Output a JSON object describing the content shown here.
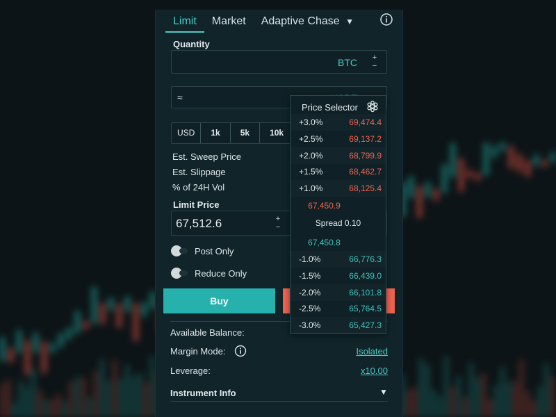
{
  "tabs": {
    "limit": "Limit",
    "market": "Market",
    "adaptive": "Adaptive Chase",
    "adaptive_arrow": "▼"
  },
  "quantity": {
    "label": "Quantity",
    "unit": "BTC",
    "stepper_up": "+",
    "stepper_down": "−"
  },
  "notional": {
    "approx": "≈",
    "unit": "USDT"
  },
  "chips": [
    "USD",
    "1k",
    "5k",
    "10k"
  ],
  "stats": {
    "sweep": "Est. Sweep Price",
    "slippage": "Est. Slippage",
    "vol": "% of 24H Vol"
  },
  "limit_price": {
    "label": "Limit Price",
    "value": "67,512.6",
    "stepper_up": "+",
    "stepper_down": "−"
  },
  "toggles": {
    "post_only": "Post Only",
    "reduce_only": "Reduce Only"
  },
  "buttons": {
    "buy": "Buy"
  },
  "info": {
    "balance_label": "Available Balance:",
    "margin_label": "Margin Mode:",
    "margin_value": "Isolated",
    "leverage_label": "Leverage:",
    "leverage_value": "x10.00",
    "instrument": "Instrument Info",
    "instrument_arrow": "▼"
  },
  "price_selector": {
    "title": "Price Selector",
    "asks": [
      {
        "pct": "+3.0%",
        "price": "69,474.4"
      },
      {
        "pct": "+2.5%",
        "price": "69,137.2"
      },
      {
        "pct": "+2.0%",
        "price": "68,799.9"
      },
      {
        "pct": "+1.5%",
        "price": "68,462.7"
      },
      {
        "pct": "+1.0%",
        "price": "68,125.4"
      }
    ],
    "best_ask": "67,450.9",
    "spread": "Spread 0.10",
    "best_bid": "67,450.8",
    "bids": [
      {
        "pct": "-1.0%",
        "price": "66,776.3"
      },
      {
        "pct": "-1.5%",
        "price": "66,439.0"
      },
      {
        "pct": "-2.0%",
        "price": "66,101.8"
      },
      {
        "pct": "-2.5%",
        "price": "65,764.5"
      },
      {
        "pct": "-3.0%",
        "price": "65,427.3"
      }
    ]
  },
  "colors": {
    "accent": "#4cc9c4",
    "buy": "#27b1ad",
    "sell": "#f0624f",
    "panel": "#10242a"
  },
  "icons": {
    "info": "info-circle-icon",
    "gear": "gear-icon",
    "dropdown": "chevron-down-icon"
  }
}
